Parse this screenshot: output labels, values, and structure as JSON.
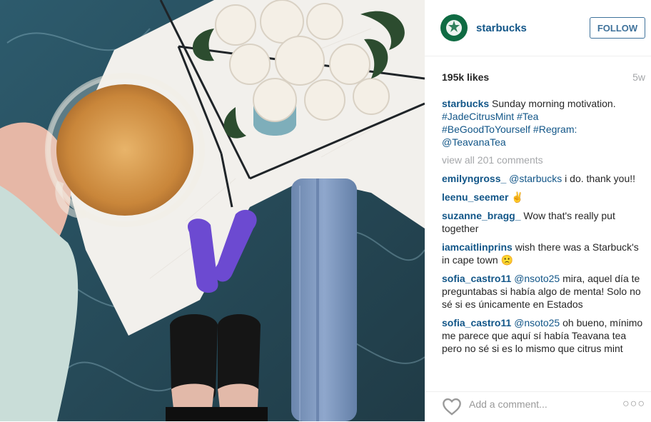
{
  "post": {
    "username": "starbucks",
    "follow_label": "FOLLOW",
    "likes": "195k likes",
    "age": "5w",
    "caption": {
      "username": "starbucks",
      "text": " Sunday morning motivation. ",
      "tags": [
        "#JadeCitrusMint",
        "#Tea",
        "#BeGoodToYourself",
        "#Regram:",
        "@TeavanaTea"
      ]
    },
    "view_all_comments": "view all 201 comments",
    "add_comment_placeholder": "Add a comment..."
  },
  "comments": [
    {
      "username": "emilyngross_",
      "text_pre": " ",
      "mention": "@starbucks",
      "text": " i do. thank you!!"
    },
    {
      "username": "leenu_seemer",
      "text_pre": " ",
      "mention": "",
      "text": " ✌"
    },
    {
      "username": "suzanne_bragg_",
      "text_pre": " ",
      "mention": "",
      "text": " Wow that's really put together"
    },
    {
      "username": "iamcaitlinprins",
      "text_pre": " ",
      "mention": "",
      "text": " wish there was a Starbuck's in cape town 🙁"
    },
    {
      "username": "sofia_castro11",
      "text_pre": " ",
      "mention": "@nsoto25",
      "text": " mira, aquel día te preguntabas si había algo de menta! Solo no sé si es únicamente en Estados"
    },
    {
      "username": "sofia_castro11",
      "text_pre": " ",
      "mention": "@nsoto25",
      "text": " oh bueno, mínimo me parece que aquí sí había Teavana tea pero no sé si es lo mismo que citrus mint"
    }
  ],
  "icons": {
    "avatar": "starbucks-logo-icon",
    "heart": "heart-outline-icon",
    "more": "more-options-icon"
  },
  "colors": {
    "link": "#125688",
    "follow": "#3f729b",
    "muted": "#a5a7aa"
  }
}
